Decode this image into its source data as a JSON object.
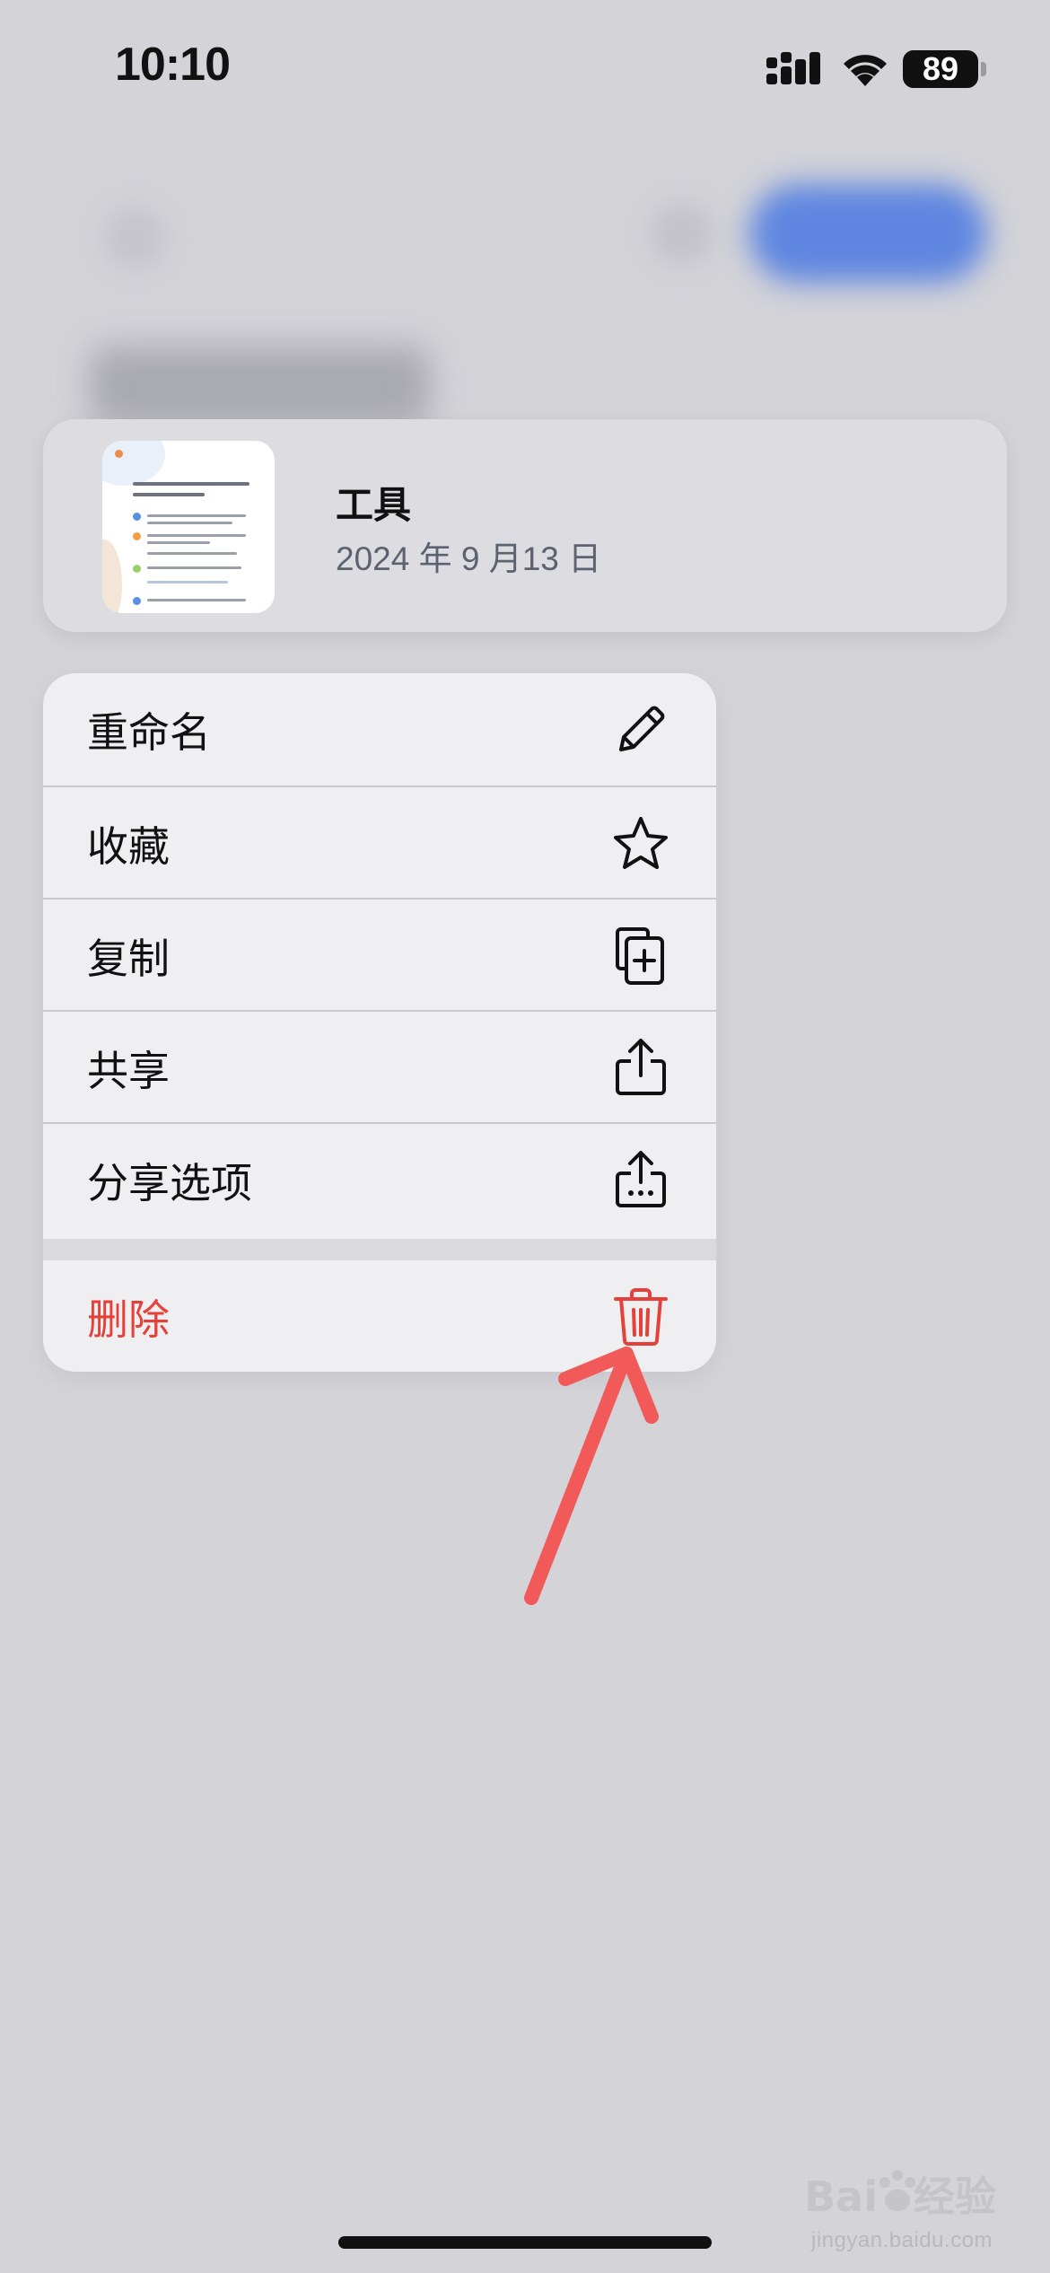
{
  "status_bar": {
    "time": "10:10",
    "battery_level": "89",
    "signal_icon": "cellular-signal-icon",
    "wifi_icon": "wifi-icon"
  },
  "background": {
    "primary_button_color": "#5e86e0"
  },
  "file_card": {
    "name": "工具",
    "date": "2024 年 9 月13 日",
    "thumbnail_icon": "document-thumbnail"
  },
  "context_menu": {
    "items": [
      {
        "label": "重命名",
        "icon": "pencil-icon"
      },
      {
        "label": "收藏",
        "icon": "star-icon"
      },
      {
        "label": "复制",
        "icon": "duplicate-icon"
      },
      {
        "label": "共享",
        "icon": "share-icon"
      },
      {
        "label": "分享选项",
        "icon": "share-options-icon"
      }
    ],
    "delete": {
      "label": "删除",
      "icon": "trash-icon",
      "color": "#e5413a"
    }
  },
  "annotation": {
    "arrow_color": "#f25a5a"
  },
  "watermark": {
    "brand": "Baidu经验",
    "url": "jingyan.baidu.com"
  }
}
